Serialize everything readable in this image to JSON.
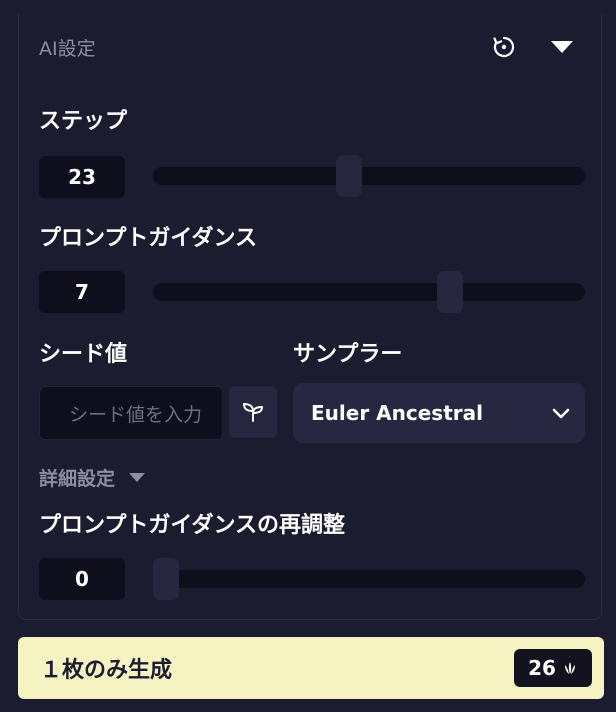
{
  "panel": {
    "title": "AI設定"
  },
  "steps": {
    "label": "ステップ",
    "value": "23",
    "fraction": 0.45
  },
  "guidance": {
    "label": "プロンプトガイダンス",
    "value": "7",
    "fraction": 0.7
  },
  "seed": {
    "label": "シード値",
    "placeholder": "シード値を入力"
  },
  "sampler": {
    "label": "サンプラー",
    "selected": "Euler Ancestral"
  },
  "advanced": {
    "label": "詳細設定"
  },
  "rescale": {
    "label": "プロンプトガイダンスの再調整",
    "value": "0",
    "fraction": 0.0
  },
  "generate": {
    "label": "１枚のみ生成",
    "cost": "26"
  },
  "icons": {
    "reset": "reset-icon",
    "collapse": "caret-down-icon",
    "seed": "sprout-icon",
    "sampler": "chevron-down-icon",
    "cost": "anlas-icon"
  },
  "colors": {
    "background": "#1c1c30",
    "input": "#0e0e1c",
    "thumb": "#26263e",
    "accent": "#f6f3c2",
    "muted": "#8d8da4"
  }
}
